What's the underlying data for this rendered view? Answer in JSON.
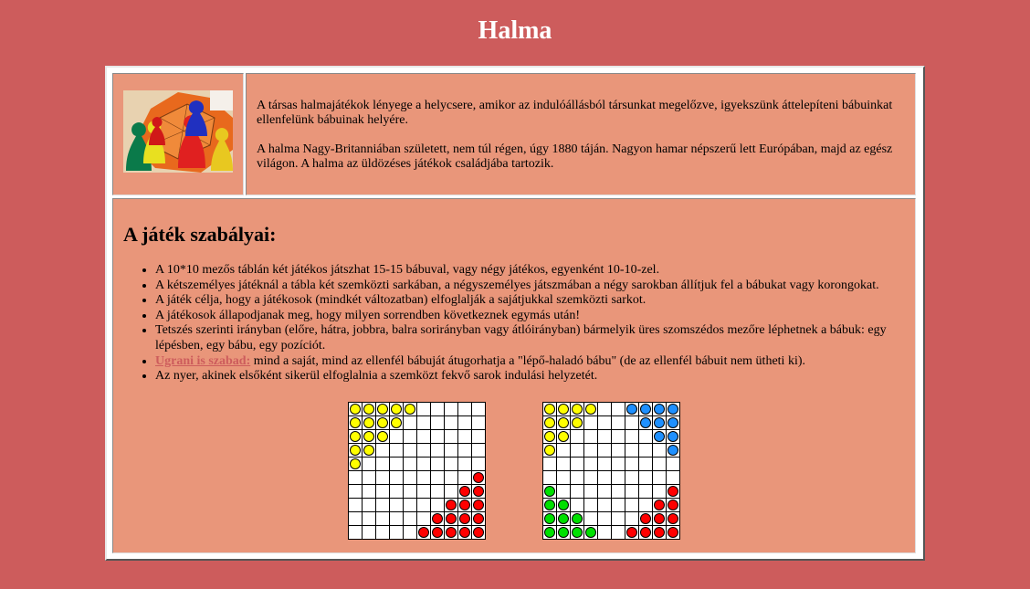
{
  "page": {
    "title": "Halma"
  },
  "intro": {
    "paragraphs": [
      "A társas halmajátékok lényege a helycsere, amikor az indulóállásból társunkat megelőzve, igyekszünk áttelepíteni bábuinkat ellenfelünk bábuinak helyére.",
      "A halma Nagy-Britanniában született, nem túl régen, úgy 1880 táján. Nagyon hamar népszerű lett Európában, majd az egész világon. A halma az üldözéses játékok családjába tartozik."
    ]
  },
  "rules": {
    "heading": "A játék szabályai:",
    "items": [
      "A 10*10 mezős táblán két játékos játszhat 15-15 bábuval, vagy négy játékos, egyenként 10-10-zel.",
      "A kétszemélyes játéknál a tábla két szemközti sarkában, a négyszemélyes játszmában a négy sarokban állítjuk fel a bábukat vagy korongokat.",
      "A játék célja, hogy a játékosok (mindkét változatban) elfoglalják a sajátjukkal szemközti sarkot.",
      "A játékosok állapodjanak meg, hogy milyen sorrendben következnek egymás után!",
      "Tetszés szerinti irányban (előre, hátra, jobbra, balra sorirányban vagy átlóirányban) bármelyik üres szomszédos mezőre léphetnek a bábuk: egy lépésben, egy bábu, egy pozíciót."
    ],
    "jump_link": "Ugrani is szabad:",
    "jump_text": " mind a saját, mind az ellenfél bábuját átugorhatja a \"lépő-haladó bábu\" (de az ellenfél bábuit nem ütheti ki).",
    "last_item": "Az nyer, akinek elsőként sikerül elfoglalnia a szemközt fekvő sarok indulási helyzetét."
  },
  "colors": {
    "yellow": "#ffff00",
    "red": "#ff0000",
    "blue": "#1e90ff",
    "green": "#00e000"
  },
  "boards": [
    {
      "name": "two-player",
      "rows": [
        "YYYYY.....",
        "YYYY......",
        "YYY.......",
        "YY........",
        "Y.........",
        ".........R",
        "........RR",
        ".......RRR",
        "......RRRR",
        ".....RRRRR"
      ]
    },
    {
      "name": "four-player",
      "rows": [
        "YYYY..BBBB",
        "YYY....BBB",
        "YY......BB",
        "Y........B",
        "..........",
        "..........",
        "G........R",
        "GG......RR",
        "GGG....RRR",
        "GGGG..RRRR"
      ]
    }
  ]
}
